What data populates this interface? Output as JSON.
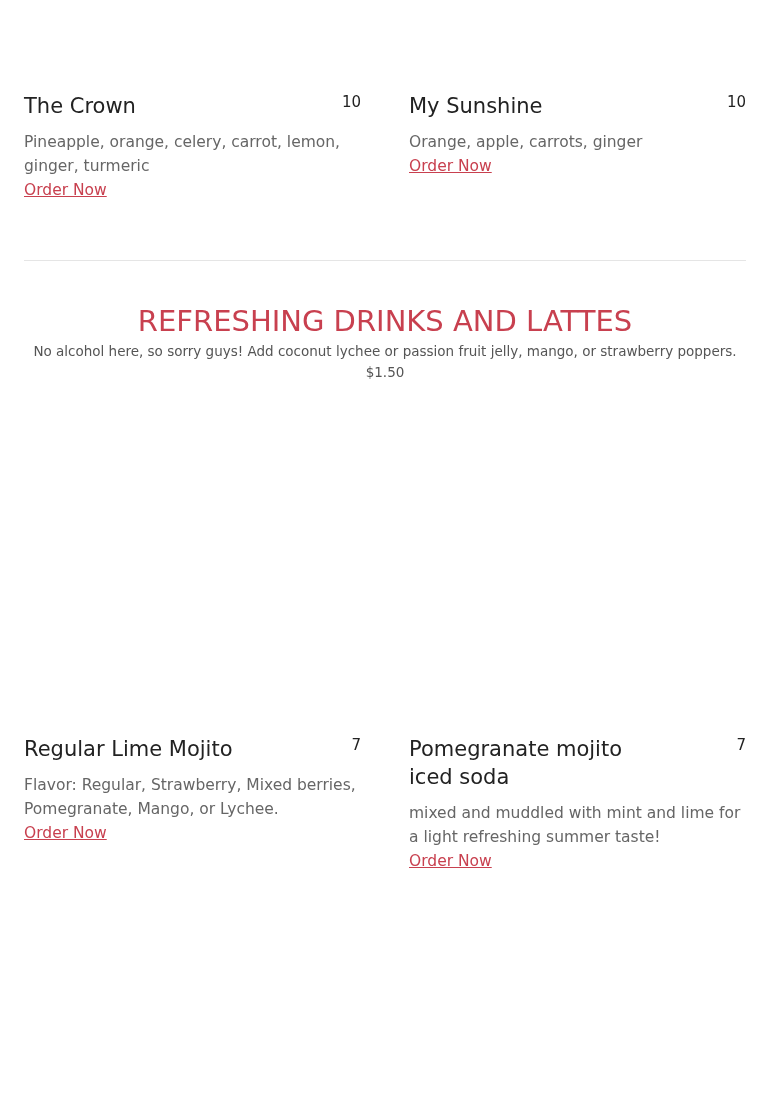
{
  "top_items": [
    {
      "name": "The Crown",
      "price": "10",
      "description": "Pineapple, orange, celery, carrot, lemon, ginger, turmeric",
      "link": "Order Now"
    },
    {
      "name": "My Sunshine",
      "price": "10",
      "description": "Orange, apple, carrots, ginger",
      "link": "Order Now"
    }
  ],
  "section": {
    "title": "REFRESHING DRINKS AND LATTES",
    "description": "No alcohol here, so sorry guys! Add coconut lychee or passion fruit jelly, mango, or strawberry poppers. $1.50",
    "items": [
      {
        "name": "Regular Lime Mojito",
        "price": "7",
        "description": "Flavor: Regular, Strawberry, Mixed berries, Pomegranate, Mango, or Lychee.",
        "link": "Order Now"
      },
      {
        "name": "Pomegranate mojito iced soda",
        "price": "7",
        "description": "mixed and muddled with mint and lime for a light refreshing summer taste!",
        "link": "Order Now"
      }
    ]
  }
}
